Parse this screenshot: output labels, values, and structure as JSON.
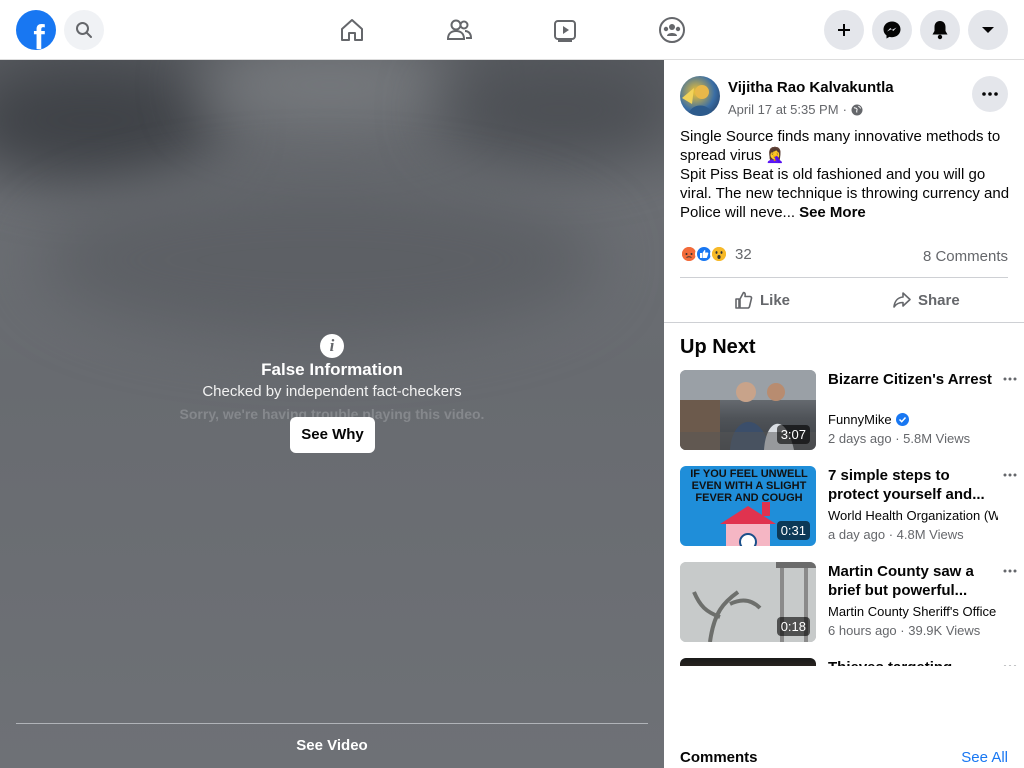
{
  "topbar": {
    "logo_letter": "f",
    "nav_icons": [
      "home-icon",
      "friends-icon",
      "watch-icon",
      "groups-icon"
    ],
    "actions": [
      "create-icon",
      "messenger-icon",
      "notifications-icon",
      "account-menu-icon"
    ],
    "accent": "#1877f2"
  },
  "video": {
    "fact_check_title": "False Information",
    "fact_check_sub": "Checked by independent fact-checkers",
    "error_text": "Sorry, we're having trouble playing this video.",
    "see_why_label": "See Why",
    "see_video_label": "See Video"
  },
  "post": {
    "author": "Vijitha Rao Kalvakuntla",
    "time": "April 17 at 5:35 PM",
    "dot": "·",
    "text_line1": "Single Source finds many innovative methods to spread virus 🤦‍♀️",
    "text_line2": "Spit Piss Beat is old fashioned and you will go viral. The new technique is throwing currency and Police will neve...",
    "see_more": "See More",
    "reaction_count": "32",
    "comments_count": "8 Comments",
    "like_label": "Like",
    "share_label": "Share"
  },
  "up_next": {
    "heading": "Up Next",
    "items": [
      {
        "title": "Bizarre Citizen's Arrest",
        "channel": "FunnyMike",
        "verified": true,
        "ago": "2 days ago",
        "views": "5.8M Views",
        "duration": "3:07"
      },
      {
        "title": "7 simple steps to protect yourself and...",
        "channel": "World Health Organization (WHO)",
        "verified": false,
        "ago": "a day ago",
        "views": "4.8M Views",
        "duration": "0:31",
        "thumb_text": "IF YOU FEEL UNWELL EVEN WITH A SLIGHT FEVER AND COUGH"
      },
      {
        "title": "Martin County saw a brief but powerful...",
        "channel": "Martin County Sheriff's Office",
        "verified": false,
        "ago": "6 hours ago",
        "views": "39.9K Views",
        "duration": "0:18"
      },
      {
        "title": "Thieves targeting..."
      }
    ]
  },
  "comments": {
    "label": "Comments",
    "see_all": "See All"
  }
}
